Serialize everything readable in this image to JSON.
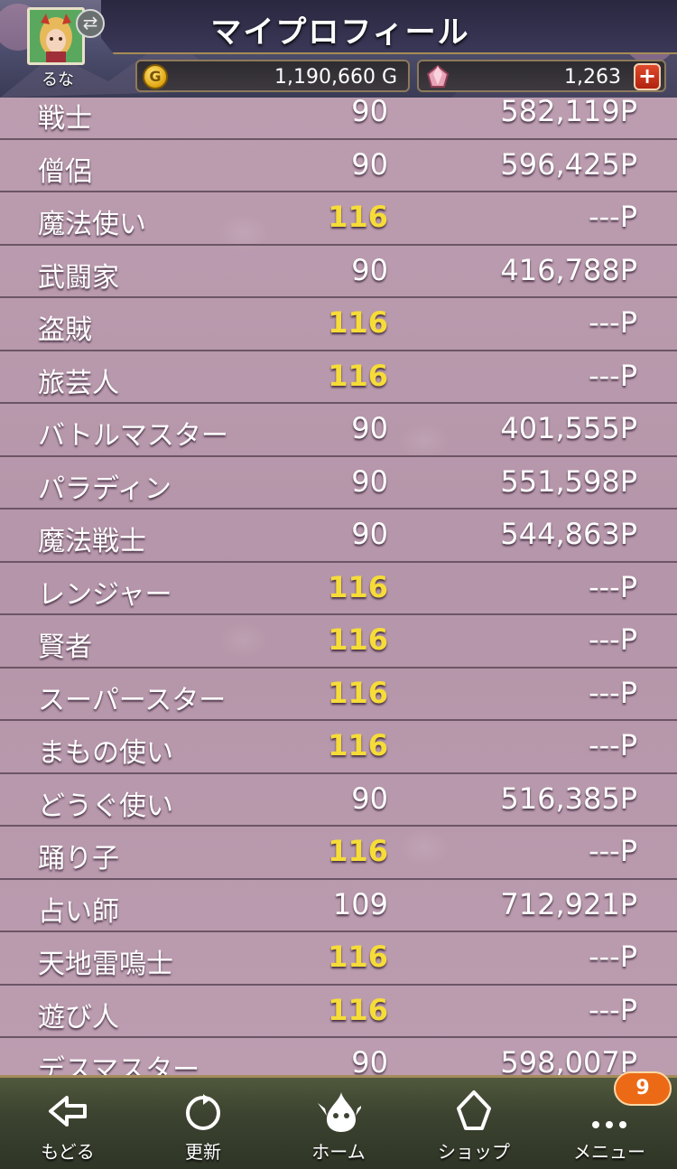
{
  "header": {
    "title": "マイプロフィール",
    "player_name": "るな",
    "gold": "1,190,660 G",
    "gems": "1,263",
    "gold_icon_glyph": "G",
    "plus_glyph": "+"
  },
  "jobs": [
    {
      "name": "戦士",
      "level": "90",
      "points": "582,119P",
      "max": false
    },
    {
      "name": "僧侶",
      "level": "90",
      "points": "596,425P",
      "max": false
    },
    {
      "name": "魔法使い",
      "level": "116",
      "points": "---P",
      "max": true
    },
    {
      "name": "武闘家",
      "level": "90",
      "points": "416,788P",
      "max": false
    },
    {
      "name": "盗賊",
      "level": "116",
      "points": "---P",
      "max": true
    },
    {
      "name": "旅芸人",
      "level": "116",
      "points": "---P",
      "max": true
    },
    {
      "name": "バトルマスター",
      "level": "90",
      "points": "401,555P",
      "max": false
    },
    {
      "name": "パラディン",
      "level": "90",
      "points": "551,598P",
      "max": false
    },
    {
      "name": "魔法戦士",
      "level": "90",
      "points": "544,863P",
      "max": false
    },
    {
      "name": "レンジャー",
      "level": "116",
      "points": "---P",
      "max": true
    },
    {
      "name": "賢者",
      "level": "116",
      "points": "---P",
      "max": true
    },
    {
      "name": "スーパースター",
      "level": "116",
      "points": "---P",
      "max": true
    },
    {
      "name": "まもの使い",
      "level": "116",
      "points": "---P",
      "max": true
    },
    {
      "name": "どうぐ使い",
      "level": "90",
      "points": "516,385P",
      "max": false
    },
    {
      "name": "踊り子",
      "level": "116",
      "points": "---P",
      "max": true
    },
    {
      "name": "占い師",
      "level": "109",
      "points": "712,921P",
      "max": false
    },
    {
      "name": "天地雷鳴士",
      "level": "116",
      "points": "---P",
      "max": true
    },
    {
      "name": "遊び人",
      "level": "116",
      "points": "---P",
      "max": true
    },
    {
      "name": "デスマスター",
      "level": "90",
      "points": "598,007P",
      "max": false
    }
  ],
  "nav": {
    "back": "もどる",
    "refresh": "更新",
    "home": "ホーム",
    "shop": "ショップ",
    "menu": "メニュー",
    "menu_badge": "9"
  },
  "colors": {
    "level_max": "#f6dc38",
    "level_normal": "#ffffff",
    "list_bg": "#b99aac",
    "badge": "#ec6a16"
  },
  "icons": [
    "swap-icon",
    "gold-icon",
    "gem-icon",
    "back-arrow-icon",
    "refresh-icon",
    "home-slime-icon",
    "shop-crystal-icon",
    "menu-dots-icon"
  ]
}
